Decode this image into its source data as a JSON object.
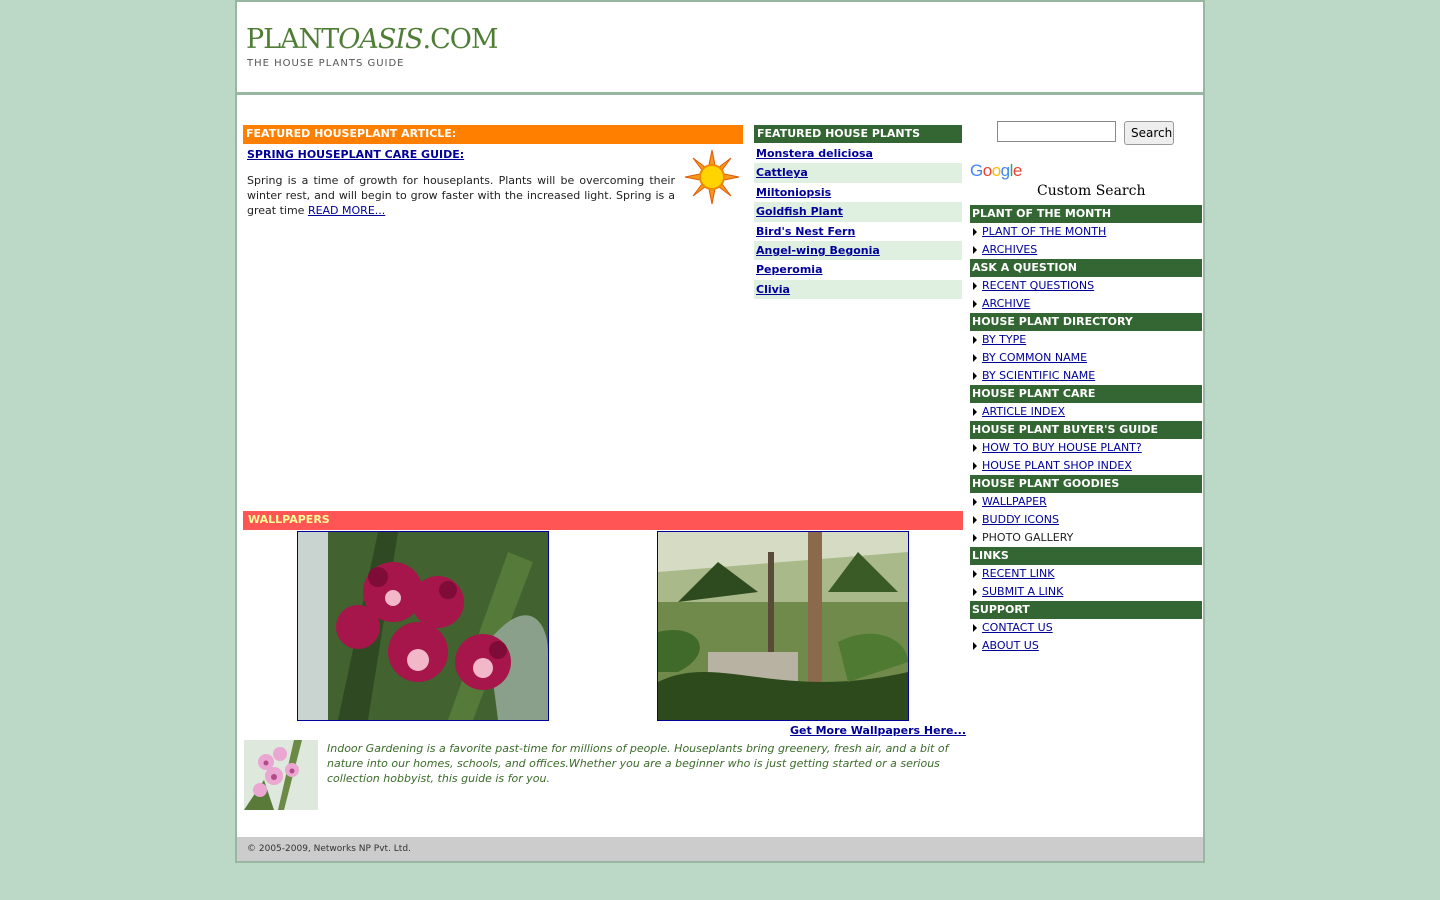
{
  "header": {
    "logo_part1": "PLANT",
    "logo_part2": "OASIS",
    "logo_part3": ".COM",
    "tagline": "THE HOUSE PLANTS GUIDE"
  },
  "article": {
    "section_title": "FEATURED HOUSEPLANT ARTICLE:",
    "title": "SPRING HOUSEPLANT CARE GUIDE:",
    "text": "Spring is a time of growth for houseplants. Plants will be overcoming their winter rest, and will begin to grow faster with the increased light. Spring is a great time ",
    "read_more": "READ MORE..."
  },
  "featured_plants": {
    "title": "FEATURED HOUSE PLANTS",
    "items": [
      "Monstera deliciosa",
      "Cattleya",
      "Miltoniopsis",
      "Goldfish Plant",
      "Bird's Nest Fern",
      "Angel-wing Begonia",
      "Peperomia",
      "Clivia"
    ]
  },
  "search": {
    "button_label": "Search",
    "value": "",
    "google_logo": [
      "G",
      "o",
      "o",
      "g",
      "l",
      "e"
    ],
    "custom_label": "Custom Search"
  },
  "nav": {
    "plant_of_month": {
      "title": "PLANT OF THE MONTH",
      "items": [
        "PLANT OF THE MONTH",
        "ARCHIVES"
      ]
    },
    "ask_question": {
      "title": "ASK A QUESTION",
      "items": [
        "RECENT QUESTIONS",
        "ARCHIVE"
      ]
    },
    "directory": {
      "title": "HOUSE PLANT DIRECTORY",
      "items": [
        "BY TYPE",
        "BY COMMON NAME",
        "BY SCIENTIFIC NAME"
      ]
    },
    "care": {
      "title": "HOUSE PLANT CARE",
      "items": [
        "ARTICLE INDEX"
      ]
    },
    "buyers_guide": {
      "title": "HOUSE PLANT BUYER'S GUIDE",
      "items": [
        "HOW TO BUY HOUSE PLANT?",
        "HOUSE PLANT SHOP INDEX"
      ]
    },
    "goodies": {
      "title": "HOUSE PLANT GOODIES",
      "items": [
        "WALLPAPER",
        "BUDDY ICONS",
        "PHOTO GALLERY"
      ]
    },
    "links": {
      "title": "LINKS",
      "items": [
        "RECENT LINK",
        "SUBMIT A LINK"
      ]
    },
    "support": {
      "title": "SUPPORT",
      "items": [
        "CONTACT US",
        "ABOUT US"
      ]
    }
  },
  "wallpapers": {
    "title": "WALLPAPERS",
    "more_link": "Get More Wallpapers Here..."
  },
  "intro_text": "Indoor Gardening is a favorite past-time for millions of people. Houseplants bring greenery, fresh air, and a bit of nature into our homes, schools, and offices.Whether you are a beginner who is just getting started or a serious collection hobbyist, this guide is for you.",
  "footer": {
    "copyright": "© 2005-2009, Networks NP Pvt. Ltd."
  },
  "colors": {
    "background": "#bcd9c8",
    "header_green": "#336633",
    "article_orange": "#ff8000",
    "wallpaper_red": "#ff5555",
    "link_blue": "#000099"
  }
}
